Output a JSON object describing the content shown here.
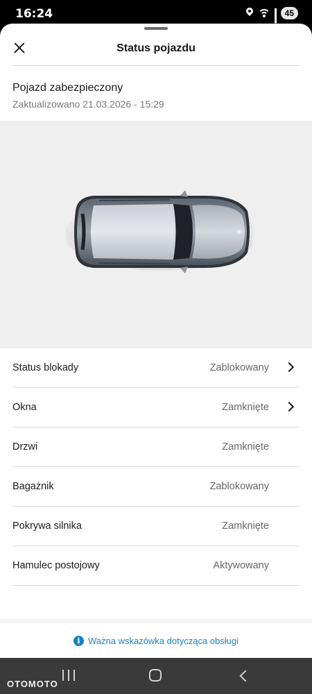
{
  "status_bar": {
    "time": "16:24",
    "battery": "45"
  },
  "header": {
    "title": "Status pojazdu"
  },
  "summary": {
    "title": "Pojazd zabezpieczony",
    "updated": "Zaktualizowano 21.03.2026 - 15:29"
  },
  "status_rows": [
    {
      "label": "Status blokady",
      "value": "Zablokowany",
      "has_chevron": true
    },
    {
      "label": "Okna",
      "value": "Zamknięte",
      "has_chevron": true
    },
    {
      "label": "Drzwi",
      "value": "Zamknięte",
      "has_chevron": false
    },
    {
      "label": "Bagażnik",
      "value": "Zablokowany",
      "has_chevron": false
    },
    {
      "label": "Pokrywa silnika",
      "value": "Zamknięte",
      "has_chevron": false
    },
    {
      "label": "Hamulec postojowy",
      "value": "Aktywowany",
      "has_chevron": false
    }
  ],
  "footer": {
    "link": "Ważna wskazówka dotycząca obsługi"
  },
  "watermark": "OTOMOTO",
  "colors": {
    "link": "#1c7fc2",
    "background": "#efefef",
    "navbar": "#3a3a3a"
  }
}
